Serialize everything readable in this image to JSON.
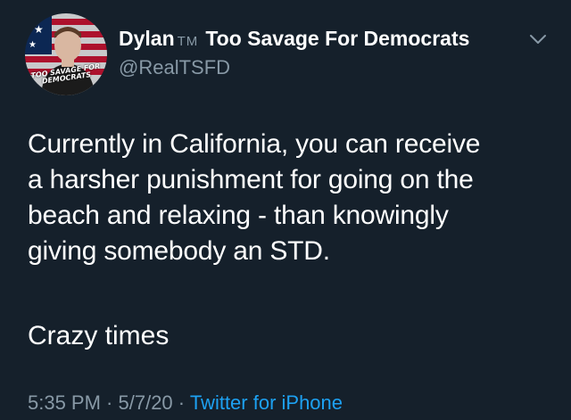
{
  "author": {
    "display_name": "Dylan",
    "trademark": "TM",
    "display_name_suffix": "Too Savage For Democrats",
    "handle": "@RealTSFD",
    "avatar_text": "TOO SAVAGE FOR DEMOCRATS"
  },
  "tweet": {
    "text": "Currently in California, you can receive\na harsher punishment for going on the\nbeach and relaxing - than knowingly\ngiving somebody an STD.",
    "text_2": "Crazy times"
  },
  "meta": {
    "time": "5:35 PM",
    "separator_1": " · ",
    "date": "5/7/20",
    "separator_2": " · ",
    "source": "Twitter for iPhone"
  },
  "icons": {
    "caret": "chevron-down-icon"
  },
  "colors": {
    "background": "#15202b",
    "secondary_text": "#8899a6",
    "link": "#1da1f2"
  }
}
